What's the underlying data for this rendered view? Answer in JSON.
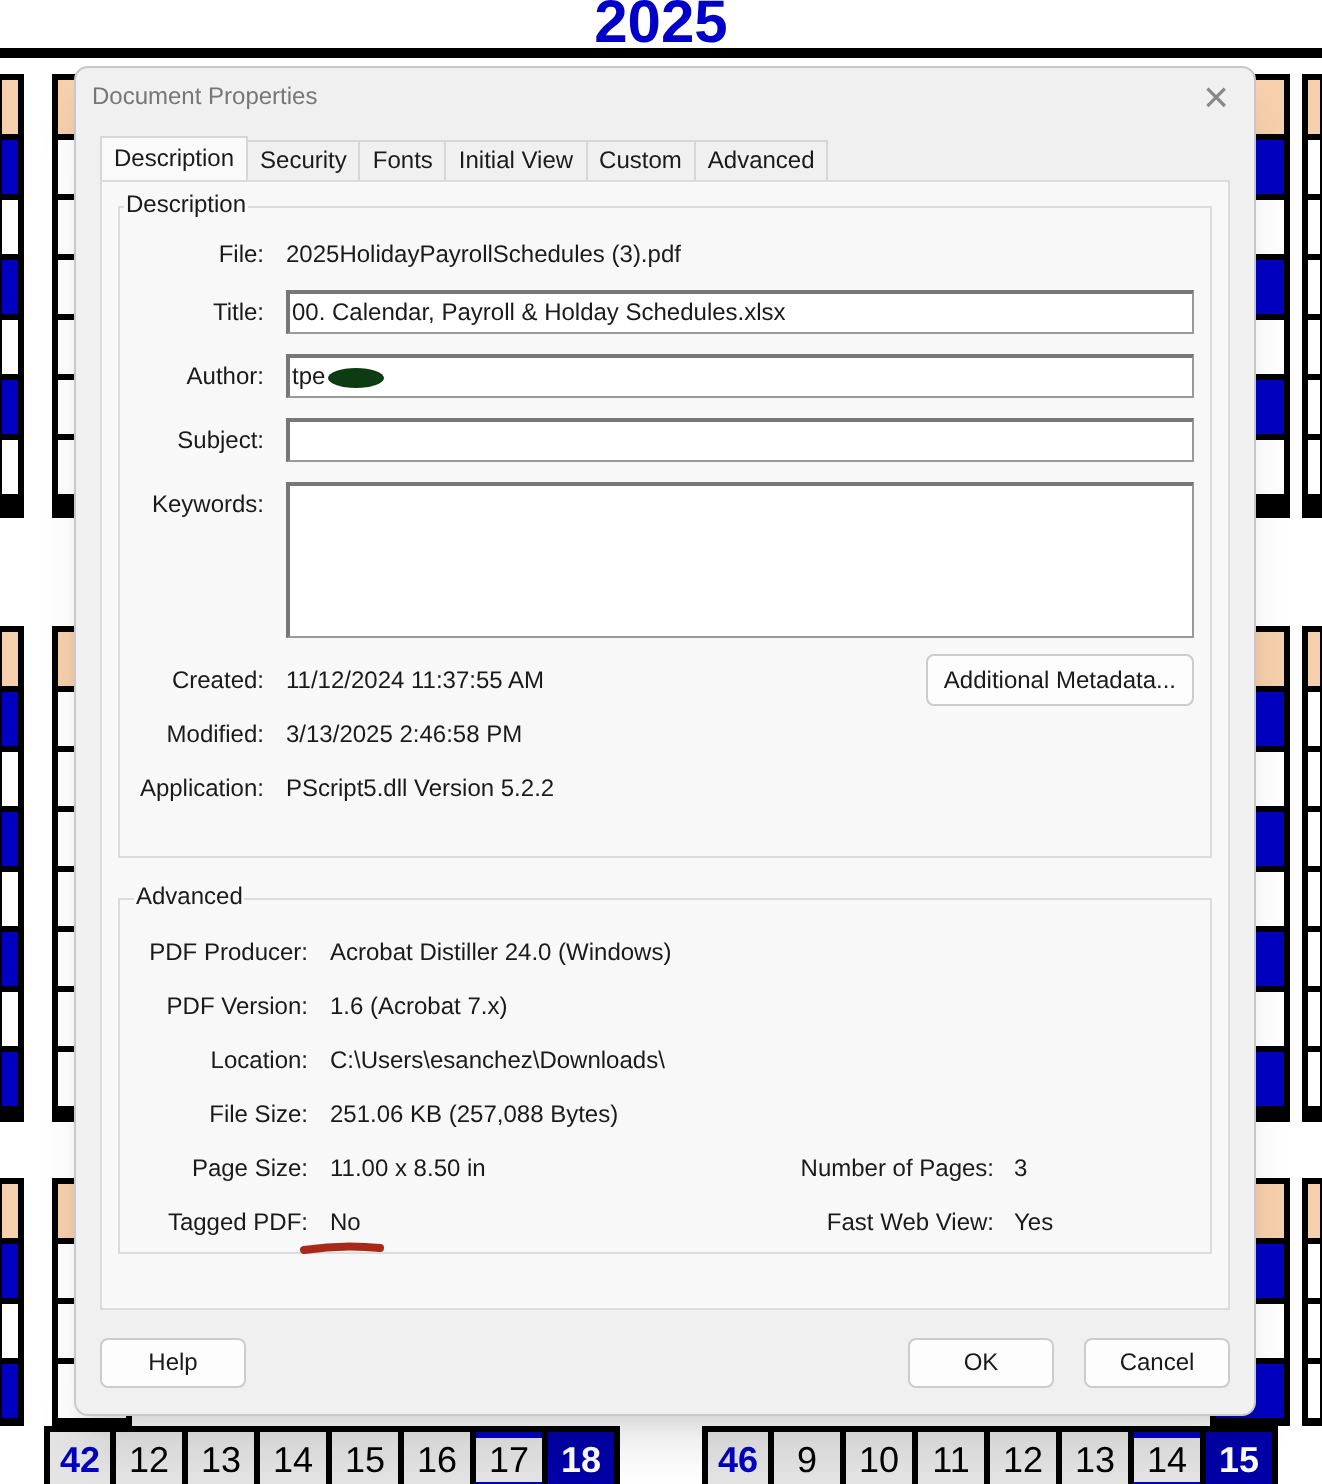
{
  "background_calendar": {
    "year": "2025",
    "week_rows": [
      {
        "week": "42",
        "days": [
          {
            "day": "12",
            "highlighted": false,
            "outlined": false
          },
          {
            "day": "13",
            "highlighted": false,
            "outlined": false
          },
          {
            "day": "14",
            "highlighted": false,
            "outlined": false
          },
          {
            "day": "15",
            "highlighted": false,
            "outlined": false
          },
          {
            "day": "16",
            "highlighted": false,
            "outlined": false
          },
          {
            "day": "17",
            "highlighted": false,
            "outlined": true
          },
          {
            "day": "18",
            "highlighted": true,
            "outlined": false
          }
        ]
      },
      {
        "week": "46",
        "days": [
          {
            "day": "9",
            "highlighted": false,
            "outlined": false
          },
          {
            "day": "10",
            "highlighted": false,
            "outlined": false
          },
          {
            "day": "11",
            "highlighted": false,
            "outlined": false
          },
          {
            "day": "12",
            "highlighted": false,
            "outlined": false
          },
          {
            "day": "13",
            "highlighted": false,
            "outlined": false
          },
          {
            "day": "14",
            "highlighted": false,
            "outlined": true
          },
          {
            "day": "15",
            "highlighted": true,
            "outlined": false
          }
        ]
      }
    ]
  },
  "window": {
    "title": "Document Properties",
    "close": "×"
  },
  "tabs": [
    {
      "label": "Description",
      "selected": true
    },
    {
      "label": "Security",
      "selected": false
    },
    {
      "label": "Fonts",
      "selected": false
    },
    {
      "label": "Initial View",
      "selected": false
    },
    {
      "label": "Custom",
      "selected": false
    },
    {
      "label": "Advanced",
      "selected": false
    }
  ],
  "description": {
    "heading": "Description",
    "fields": [
      {
        "kind": "text",
        "label": "File:",
        "value": "2025HolidayPayrollSchedules (3).pdf"
      },
      {
        "kind": "field",
        "label": "Title:",
        "value": "00. Calendar, Payroll & Holday Schedules.xlsx"
      },
      {
        "kind": "field",
        "label": "Author:",
        "value": "tpe",
        "redacted": true
      },
      {
        "kind": "field",
        "label": "Subject:"
      },
      {
        "kind": "area",
        "label": "Keywords:"
      }
    ],
    "dates": [
      {
        "label": "Created:",
        "value": "11/12/2024 11:37:55 AM"
      },
      {
        "label": "Modified:",
        "value": "3/13/2025 2:46:58 PM"
      },
      {
        "label": "Application:",
        "value": "PScript5.dll Version 5.2.2"
      }
    ],
    "metadata_button": "Additional Metadata..."
  },
  "advanced": {
    "heading": "Advanced",
    "rows": [
      {
        "label": "PDF Producer:",
        "value": "Acrobat Distiller 24.0 (Windows)"
      },
      {
        "label": "PDF Version:",
        "value": "1.6 (Acrobat 7.x)"
      },
      {
        "label": "Location:",
        "value": "C:\\Users\\esanchez\\Downloads\\"
      },
      {
        "label": "File Size:",
        "value": "251.06 KB (257,088 Bytes)"
      },
      {
        "label": "Page Size:",
        "value": "11.00 x 8.50 in",
        "right_label": "Number of Pages:",
        "right_value": "3"
      },
      {
        "label": "Tagged PDF:",
        "value": "No",
        "right_label": "Fast Web View:",
        "right_value": "Yes",
        "underlined": true
      }
    ]
  },
  "buttons": {
    "help": "Help",
    "ok": "OK",
    "cancel": "Cancel"
  }
}
